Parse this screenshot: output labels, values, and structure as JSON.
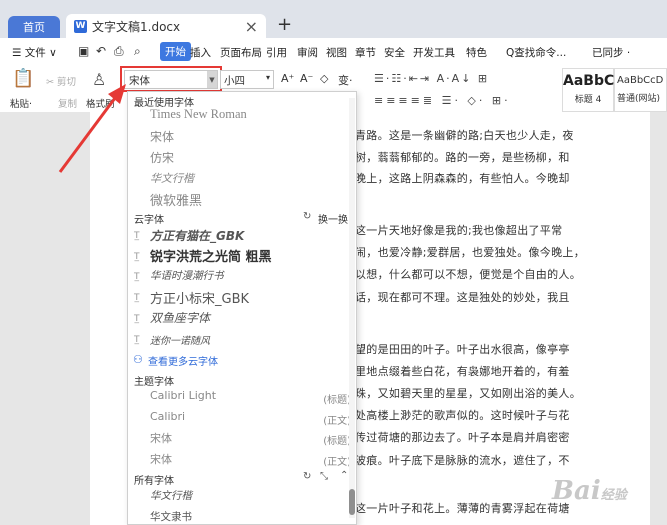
{
  "tabs": {
    "home": "首页",
    "document": "文字文稿1.docx",
    "close": "×",
    "add": "+"
  },
  "menubar": {
    "file": "☰ 文件 ∨",
    "items": [
      "开始",
      "插入",
      "页面布局",
      "引用",
      "审阅",
      "视图",
      "章节",
      "安全",
      "开发工具",
      "特色"
    ],
    "search": "Q查找命令...",
    "sync": "已同步 ·"
  },
  "ribbon": {
    "paste": "粘贴·",
    "cut": "✂ 剪切",
    "copy": "复制",
    "format_painter": "格式刷",
    "font_name": "宋体",
    "font_size": "小四",
    "grow": "A⁺",
    "shrink": "A⁻",
    "clear": "◇",
    "pinyin": "变·",
    "style1_preview": "AaBbC",
    "style1_label": "标题 4",
    "style2_preview": "AaBbCcD",
    "style2_label": "普通(网站)"
  },
  "dropdown": {
    "recent_header": "最近使用字体",
    "recent": [
      "Times New Roman",
      "宋体",
      "仿宋",
      "华文行楷",
      "微软雅黑"
    ],
    "cloud_header": "云字体",
    "cloud_action": "换一换",
    "cloud": [
      "方正有猫在_GBK",
      "锐字洪荒之光简 粗黑",
      "华语时漫潮行书",
      "方正小标宋_GBK",
      "双鱼座字体",
      "迷你一诺随风"
    ],
    "more_cloud": "查看更多云字体",
    "theme_header": "主题字体",
    "theme": [
      {
        "name": "Calibri Light",
        "tag": "(标题)"
      },
      {
        "name": "Calibri",
        "tag": "(正文)"
      },
      {
        "name": "宋体",
        "tag": "(标题)"
      },
      {
        "name": "宋体",
        "tag": "(正文)"
      }
    ],
    "all_header": "所有字体",
    "all": [
      "华文行楷",
      "华文隶书"
    ]
  },
  "document": {
    "lines": [
      "青路。这是一条幽僻的路;白天也少人走，夜",
      "树，蓊蓊郁郁的。路的一旁，是些杨柳，和",
      "晚上，这路上阴森森的，有些怕人。今晚却",
      "这一片天地好像是我的;我也像超出了平常",
      "闹，也爱冷静;爱群居，也爱独处。像今晚上，",
      "以想，什么都可以不想，便觉是个自由的人。",
      "话，现在都可不理。这是独处的妙处，我且",
      "望的是田田的叶子。叶子出水很高，像亭亭",
      "里地点缀着些白花，有袅娜地开着的，有羞",
      "珠，又如碧天里的星星，又如刚出浴的美人。",
      "处高楼上渺茫的歌声似的。这时候叶子与花",
      "传过荷塘的那边去了。叶子本是肩并肩密密",
      "波痕。叶子底下是脉脉的流水，遮住了，不",
      "这一片叶子和花上。薄薄的青雾浮起在荷塘"
    ]
  },
  "watermark": "Bai 经验",
  "colors": {
    "accent": "#3d78e0",
    "highlight_box": "#e53935",
    "arrow": "#e53935"
  }
}
